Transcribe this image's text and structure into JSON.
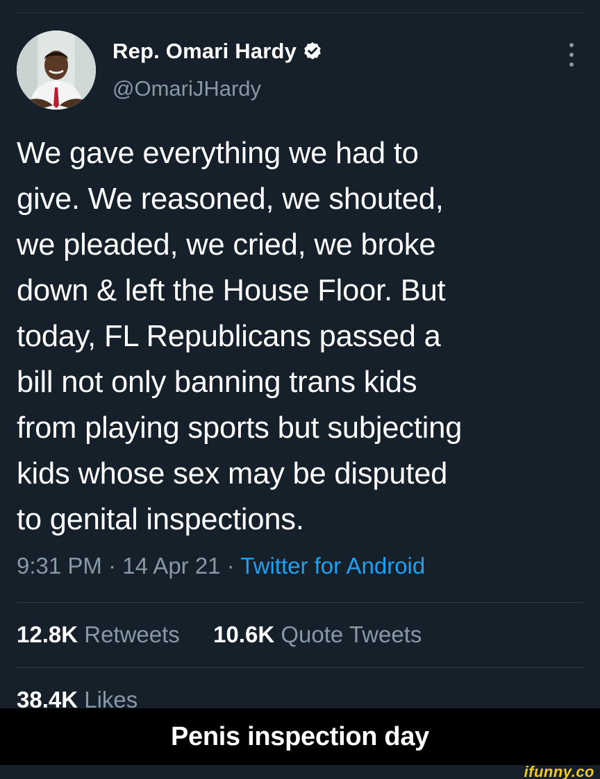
{
  "author": {
    "display_name": "Rep. Omari Hardy",
    "handle": "@OmariJHardy",
    "verified": true,
    "avatar_icon": "profile-photo"
  },
  "tweet": {
    "lines": [
      "We gave everything we had to",
      "give. We reasoned, we shouted,",
      "we pleaded, we cried, we broke",
      "down & left the House Floor. But",
      "today, FL Republicans passed a",
      "bill not only banning trans kids",
      "from playing sports but subjecting",
      "kids whose sex may be disputed",
      "to genital inspections."
    ],
    "time": "9:31 PM",
    "date": "14 Apr 21",
    "separator": "·",
    "source": "Twitter for Android"
  },
  "stats": {
    "retweets_count": "12.8K",
    "retweets_label": "Retweets",
    "quotes_count": "10.6K",
    "quotes_label": "Quote Tweets",
    "likes_count": "38.4K",
    "likes_label": "Likes"
  },
  "caption": "Penis inspection day",
  "watermark": "ifunny.co",
  "colors": {
    "background": "#15202b",
    "link": "#1da1f2",
    "secondary_text": "#8899a6",
    "caption_bar": "#000000",
    "watermark": "#f2c81f"
  }
}
